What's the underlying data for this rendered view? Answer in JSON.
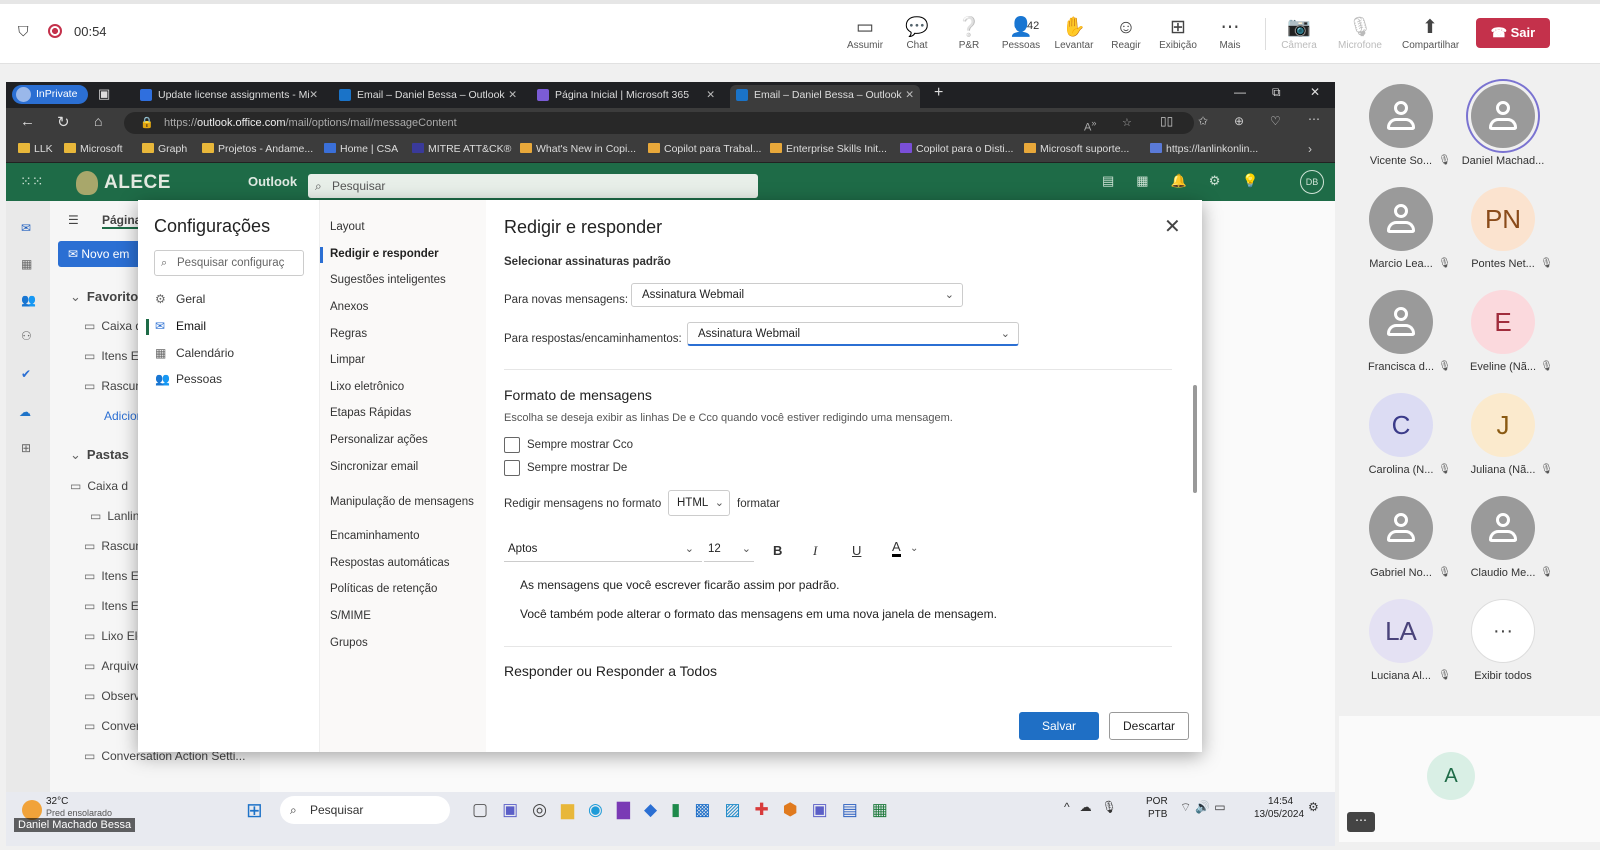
{
  "teams": {
    "timer": "00:54",
    "toolbar": [
      {
        "label": "Assumir",
        "icon": "take-control-icon",
        "glyph": "▭"
      },
      {
        "label": "Chat",
        "icon": "chat-icon",
        "glyph": "💬"
      },
      {
        "label": "P&R",
        "icon": "qa-icon",
        "glyph": "❔"
      },
      {
        "label": "Pessoas",
        "icon": "people-icon",
        "glyph": "👤",
        "count": "42"
      },
      {
        "label": "Levantar",
        "icon": "raise-hand-icon",
        "glyph": "✋"
      },
      {
        "label": "Reagir",
        "icon": "react-icon",
        "glyph": "☺"
      },
      {
        "label": "Exibição",
        "icon": "view-icon",
        "glyph": "⊞"
      },
      {
        "label": "Mais",
        "icon": "more-icon",
        "glyph": "⋯"
      },
      {
        "label": "Câmera",
        "icon": "camera-off-icon",
        "glyph": "📷"
      },
      {
        "label": "Microfone",
        "icon": "mic-off-icon",
        "glyph": "🎙"
      },
      {
        "label": "Compartilhar",
        "icon": "share-icon",
        "glyph": "⬆"
      }
    ],
    "leave_label": "Sair",
    "participants": [
      {
        "name": "Vicente So...",
        "initials": "",
        "bg": "#9a9a9a",
        "fg": "#fff"
      },
      {
        "name": "Daniel Machad...",
        "initials": "",
        "bg": "#9a9a9a",
        "fg": "#fff",
        "speaking": true
      },
      {
        "name": "Marcio Lea...",
        "initials": "",
        "bg": "#9a9a9a",
        "fg": "#fff"
      },
      {
        "name": "Pontes Net...",
        "initials": "PN",
        "bg": "#fbe3cf",
        "fg": "#8a4b1a"
      },
      {
        "name": "Francisca d...",
        "initials": "",
        "bg": "#9a9a9a",
        "fg": "#fff"
      },
      {
        "name": "Eveline (Nã...",
        "initials": "E",
        "bg": "#fbd9dd",
        "fg": "#a02c3c"
      },
      {
        "name": "Carolina (N...",
        "initials": "C",
        "bg": "#dcdcf3",
        "fg": "#3b3b8a"
      },
      {
        "name": "Juliana (Nã...",
        "initials": "J",
        "bg": "#fbeacd",
        "fg": "#8a5a12"
      },
      {
        "name": "Gabriel No...",
        "initials": "",
        "bg": "#9a9a9a",
        "fg": "#fff"
      },
      {
        "name": "Claudio Me...",
        "initials": "",
        "bg": "#9a9a9a",
        "fg": "#fff"
      },
      {
        "name": "Luciana Al...",
        "initials": "LA",
        "bg": "#e4e1f3",
        "fg": "#4a437a"
      },
      {
        "name": "Exibir todos",
        "initials": "···",
        "bg": "#ffffff",
        "fg": "#444"
      }
    ],
    "self_initial": "A",
    "presenter_name": "Daniel Machado Bessa"
  },
  "browser": {
    "inprivate": "InPrivate",
    "tabs": [
      {
        "title": "Update license assignments - Mi",
        "color": "#2f6fde"
      },
      {
        "title": "Email – Daniel Bessa – Outlook",
        "color": "#1a73c8"
      },
      {
        "title": "Página Inicial | Microsoft 365",
        "color": "#7b5cd6"
      },
      {
        "title": "Email – Daniel Bessa – Outlook",
        "color": "#1a73c8"
      }
    ],
    "url_prefix": "https://",
    "url_host": "outlook.office.com",
    "url_path": "/mail/options/mail/messageContent",
    "favorites": [
      "LLK",
      "Microsoft",
      "Graph",
      "Projetos - Andame...",
      "Home | CSA",
      "MITRE ATT&CK®",
      "What's New in Copi...",
      "Copilot para Trabal...",
      "Enterprise Skills Init...",
      "Copilot para o Disti...",
      "Microsoft suporte...",
      "https://lanlinkonlin..."
    ]
  },
  "owa": {
    "brand": "ALECE",
    "app": "Outlook",
    "search_placeholder": "Pesquisar",
    "user_initials": "DB",
    "tab_label": "Página",
    "new_mail": "Novo em",
    "nav": [
      "Favoritos",
      "Caixa de",
      "Itens En",
      "Rascun",
      "Adicion",
      "Pastas",
      "Caixa d",
      "Lanlin",
      "Rascun",
      "Itens En",
      "Itens Ex",
      "Lixo Ele",
      "Arquivo",
      "Observa",
      "Convers",
      "Conversation Action Setti..."
    ]
  },
  "settings": {
    "title": "Configurações",
    "search_placeholder": "Pesquisar configuraç",
    "categories": [
      "Geral",
      "Email",
      "Calendário",
      "Pessoas"
    ],
    "subnav": [
      "Layout",
      "Redigir e responder",
      "Sugestões inteligentes",
      "Anexos",
      "Regras",
      "Limpar",
      "Lixo eletrônico",
      "Etapas Rápidas",
      "Personalizar ações",
      "Sincronizar email",
      "Manipulação de mensagens",
      "Encaminhamento",
      "Respostas automáticas",
      "Políticas de retenção",
      "S/MIME",
      "Grupos"
    ],
    "panel_title": "Redigir e responder",
    "sig_heading": "Selecionar assinaturas padrão",
    "sig_new_label": "Para novas mensagens:",
    "sig_new_value": "Assinatura Webmail",
    "sig_reply_label": "Para respostas/encaminhamentos:",
    "sig_reply_value": "Assinatura Webmail",
    "format_heading": "Formato de mensagens",
    "format_desc": "Escolha se deseja exibir as linhas De e Cco quando você estiver redigindo uma mensagem.",
    "show_bcc": "Sempre mostrar Cco",
    "show_from": "Sempre mostrar De",
    "compose_label": "Redigir mensagens no formato",
    "compose_value": "HTML",
    "compose_suffix": "formatar",
    "font_value": "Aptos",
    "size_value": "12",
    "preview_1": "As mensagens que você escrever ficarão assim por padrão.",
    "preview_2": "Você também pode alterar o formato das mensagens em uma nova janela de mensagem.",
    "reply_heading": "Responder ou Responder a Todos",
    "save": "Salvar",
    "discard": "Descartar"
  },
  "taskbar": {
    "temp": "32°C",
    "weather": "Pred ensolarado",
    "search": "Pesquisar",
    "lang1": "POR",
    "lang2": "PTB",
    "time": "14:54",
    "date": "13/05/2024"
  }
}
